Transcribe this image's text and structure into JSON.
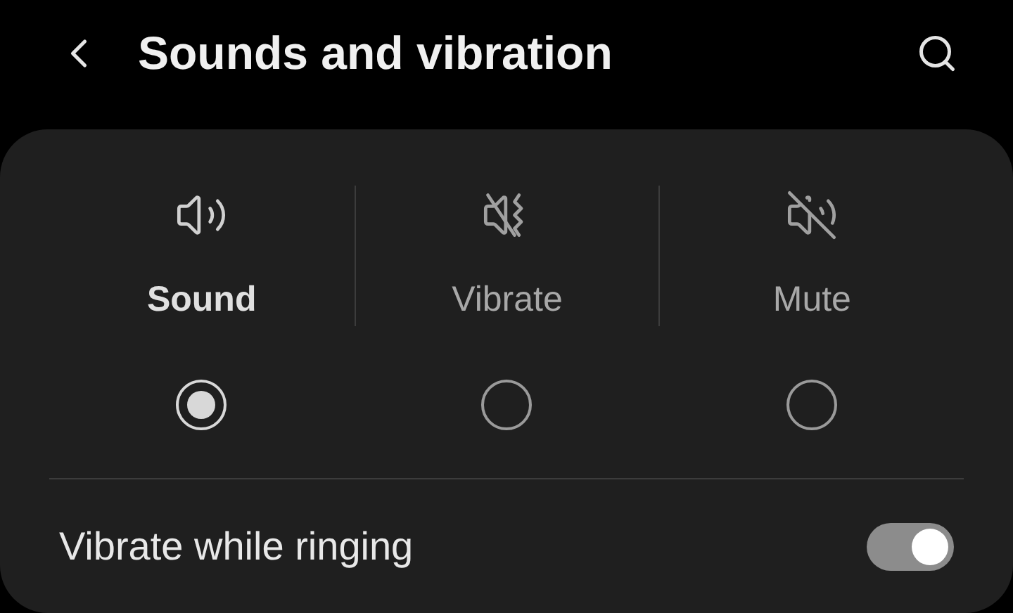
{
  "header": {
    "title": "Sounds and vibration"
  },
  "sound_modes": [
    {
      "kind": "sound",
      "label": "Sound",
      "selected": true
    },
    {
      "kind": "vibrate",
      "label": "Vibrate",
      "selected": false
    },
    {
      "kind": "mute",
      "label": "Mute",
      "selected": false
    }
  ],
  "settings": [
    {
      "label": "Vibrate while ringing",
      "on": true
    }
  ]
}
